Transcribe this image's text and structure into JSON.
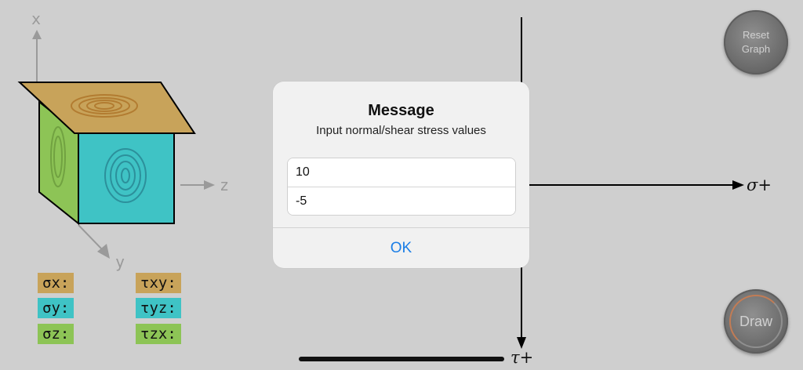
{
  "cube": {
    "axis_x": "x",
    "axis_y": "y",
    "axis_z": "z"
  },
  "stress_labels": {
    "sigma_x": "σx:",
    "sigma_y": "σy:",
    "sigma_z": "σz:",
    "tau_xy": "τxy:",
    "tau_yz": "τyz:",
    "tau_zx": "τzx:"
  },
  "buttons": {
    "reset_line1": "Reset",
    "reset_line2": "Graph",
    "draw": "Draw"
  },
  "graph": {
    "sigma_label": "σ+",
    "tau_label": "τ+"
  },
  "dialog": {
    "title": "Message",
    "message": "Input normal/shear stress values",
    "normal_value": "10",
    "shear_value": "-5",
    "ok_label": "OK"
  },
  "colors": {
    "gold": "#c8a35a",
    "teal": "#3fc3c5",
    "green": "#8dc456",
    "accent": "#1b7ee6"
  }
}
